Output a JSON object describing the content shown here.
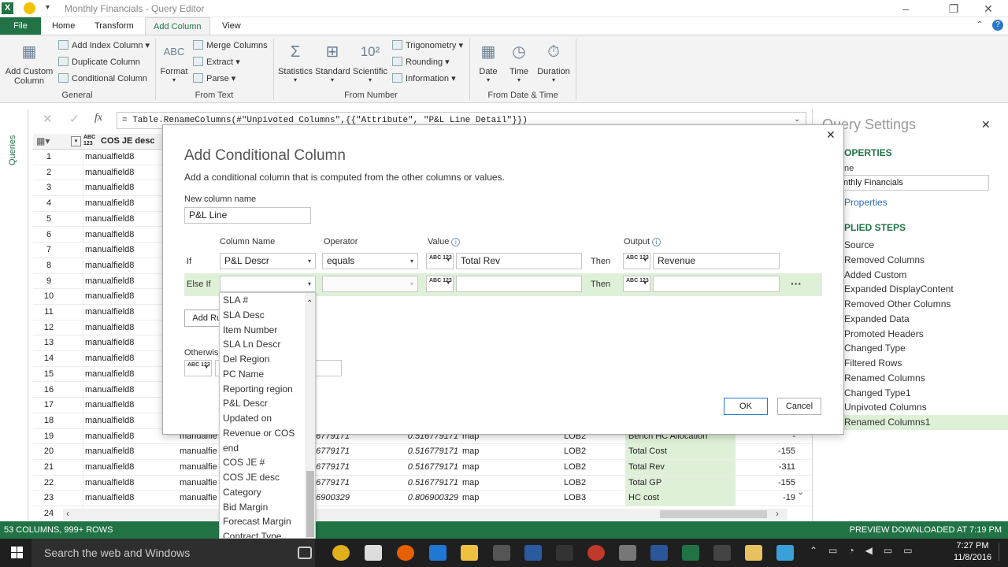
{
  "window": {
    "title": "Monthly Financials - Query Editor",
    "app_icon": "X",
    "colors": {
      "brand": "#217346"
    }
  },
  "tabs": [
    {
      "label": "File"
    },
    {
      "label": "Home"
    },
    {
      "label": "Transform"
    },
    {
      "label": "Add Column"
    },
    {
      "label": "View"
    }
  ],
  "ribbon": {
    "general": {
      "label": "General",
      "add_custom_column": "Add Custom Column",
      "add_index_column": "Add Index Column",
      "duplicate_column": "Duplicate Column",
      "conditional_column": "Conditional Column"
    },
    "from_text": {
      "label": "From Text",
      "format": "Format",
      "merge_columns": "Merge Columns",
      "extract": "Extract",
      "parse": "Parse"
    },
    "from_number": {
      "label": "From Number",
      "statistics": "Statistics",
      "standard": "Standard",
      "scientific": "Scientific",
      "trigonometry": "Trigonometry",
      "rounding": "Rounding",
      "information": "Information"
    },
    "from_date_time": {
      "label": "From Date & Time",
      "date": "Date",
      "time": "Time",
      "duration": "Duration"
    }
  },
  "formula_bar": {
    "text": "= Table.RenameColumns(#\"Unpivoted Columns\",{{\"Attribute\", \"P&L Line Detail\"}})"
  },
  "queries_label": "Queries",
  "grid": {
    "header": {
      "type": "ABC 123",
      "col1": "COS JE desc"
    },
    "rows": [
      {
        "n": "1",
        "c1": "manualfield8"
      },
      {
        "n": "2",
        "c1": "manualfield8"
      },
      {
        "n": "3",
        "c1": "manualfield8"
      },
      {
        "n": "4",
        "c1": "manualfield8"
      },
      {
        "n": "5",
        "c1": "manualfield8"
      },
      {
        "n": "6",
        "c1": "manualfield8"
      },
      {
        "n": "7",
        "c1": "manualfield8"
      },
      {
        "n": "8",
        "c1": "manualfield8"
      },
      {
        "n": "9",
        "c1": "manualfield8"
      },
      {
        "n": "10",
        "c1": "manualfield8"
      },
      {
        "n": "11",
        "c1": "manualfield8"
      },
      {
        "n": "12",
        "c1": "manualfield8"
      },
      {
        "n": "13",
        "c1": "manualfield8"
      },
      {
        "n": "14",
        "c1": "manualfield8"
      },
      {
        "n": "15",
        "c1": "manualfield8"
      },
      {
        "n": "16",
        "c1": "manualfield8"
      },
      {
        "n": "17",
        "c1": "manualfield8"
      },
      {
        "n": "18",
        "c1": "manualfield8"
      },
      {
        "n": "19",
        "c1": "manualfield8",
        "c2": "manualfie",
        "c3": "6779171",
        "c4": "0.516779171",
        "c5": "map",
        "c6": "LOB2",
        "c7": "Bench HC Allocation",
        "c8": "-"
      },
      {
        "n": "20",
        "c1": "manualfield8",
        "c2": "manualfie",
        "c3": "6779171",
        "c4": "0.516779171",
        "c5": "map",
        "c6": "LOB2",
        "c7": "Total Cost",
        "c8": "-155"
      },
      {
        "n": "21",
        "c1": "manualfield8",
        "c2": "manualfie",
        "c3": "6779171",
        "c4": "0.516779171",
        "c5": "map",
        "c6": "LOB2",
        "c7": "Total Rev",
        "c8": "-311"
      },
      {
        "n": "22",
        "c1": "manualfield8",
        "c2": "manualfie",
        "c3": "6779171",
        "c4": "0.516779171",
        "c5": "map",
        "c6": "LOB2",
        "c7": "Total GP",
        "c8": "-155"
      },
      {
        "n": "23",
        "c1": "manualfield8",
        "c2": "manualfie",
        "c3": "6900329",
        "c4": "0.806900329",
        "c5": "map",
        "c6": "LOB3",
        "c7": "HC cost",
        "c8": "-19"
      },
      {
        "n": "24",
        "c1": ""
      }
    ]
  },
  "status": {
    "left": "53 COLUMNS, 999+ ROWS",
    "right": "PREVIEW DOWNLOADED AT 7:19 PM"
  },
  "settings": {
    "title": "Query Settings",
    "properties_heading": "OPERTIES",
    "name_label": "ne",
    "name_value": "nthly Financials",
    "all_properties": "Properties",
    "applied_steps_heading": "PLIED STEPS",
    "steps": [
      {
        "label": "Source",
        "gear": true
      },
      {
        "label": "Removed Columns",
        "gear": false
      },
      {
        "label": "Added Custom",
        "gear": true
      },
      {
        "label": "Expanded DisplayContent",
        "gear": true
      },
      {
        "label": "Removed Other Columns",
        "gear": true
      },
      {
        "label": "Expanded Data",
        "gear": true
      },
      {
        "label": "Promoted Headers",
        "gear": false
      },
      {
        "label": "Changed Type",
        "gear": false
      },
      {
        "label": "Filtered Rows",
        "gear": true
      },
      {
        "label": "Renamed Columns",
        "gear": false
      },
      {
        "label": "Changed Type1",
        "gear": false
      },
      {
        "label": "Unpivoted Columns",
        "gear": false
      },
      {
        "label": "Renamed Columns1",
        "gear": false
      }
    ]
  },
  "dialog": {
    "title": "Add Conditional Column",
    "description": "Add a conditional column that is computed from the other columns or values.",
    "new_column_label": "New column name",
    "new_column_value": "P&L Line",
    "headers": {
      "column_name": "Column Name",
      "operator": "Operator",
      "value": "Value",
      "output": "Output"
    },
    "rule1": {
      "prefix": "If",
      "column": "P&L Descr",
      "operator": "equals",
      "value": "Total Rev",
      "then": "Then",
      "output": "Revenue"
    },
    "rule2": {
      "prefix": "Else If",
      "then": "Then"
    },
    "add_rule": "Add Rul",
    "otherwise": "Otherwis",
    "type_label": "ABC 123",
    "ok": "OK",
    "cancel": "Cancel"
  },
  "dropdown": {
    "items": [
      "SLA #",
      "SLA Desc",
      "Item Number",
      "SLA Ln Descr",
      "Del Region",
      "PC Name",
      "Reporting region",
      "P&L Descr",
      "Updated on",
      "Revenue or COS",
      "end",
      "COS JE #",
      "COS JE desc",
      "Category",
      "Bid Margin",
      "Forecast Margin",
      "Contract Type"
    ]
  },
  "taskbar": {
    "search": "Search the web and Windows",
    "time": "7:27 PM",
    "date": "11/8/2016"
  }
}
